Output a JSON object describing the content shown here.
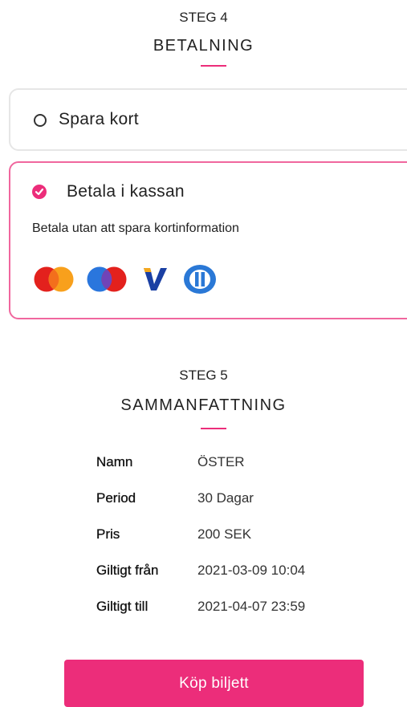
{
  "step4": {
    "label": "STEG 4",
    "title": "BETALNING"
  },
  "payment_options": [
    {
      "label": "Spara kort",
      "selected": false
    },
    {
      "label": "Betala i kassan",
      "selected": true,
      "description": "Betala utan att spara kortinformation"
    }
  ],
  "card_icons": [
    "mastercard-icon",
    "maestro-icon",
    "visa-electron-icon",
    "diners-club-icon"
  ],
  "step5": {
    "label": "STEG 5",
    "title": "SAMMANFATTNING"
  },
  "summary": [
    {
      "key": "Namn",
      "value": "ÖSTER"
    },
    {
      "key": "Period",
      "value": "30 Dagar"
    },
    {
      "key": "Pris",
      "value": "200 SEK"
    },
    {
      "key": "Giltigt från",
      "value": "2021-03-09 10:04"
    },
    {
      "key": "Giltigt till",
      "value": "2021-04-07 23:59"
    }
  ],
  "buy_button_label": "Köp biljett",
  "colors": {
    "accent": "#ec2d7a",
    "selected_border": "#f0679e",
    "card_border": "#e6e6e6"
  }
}
